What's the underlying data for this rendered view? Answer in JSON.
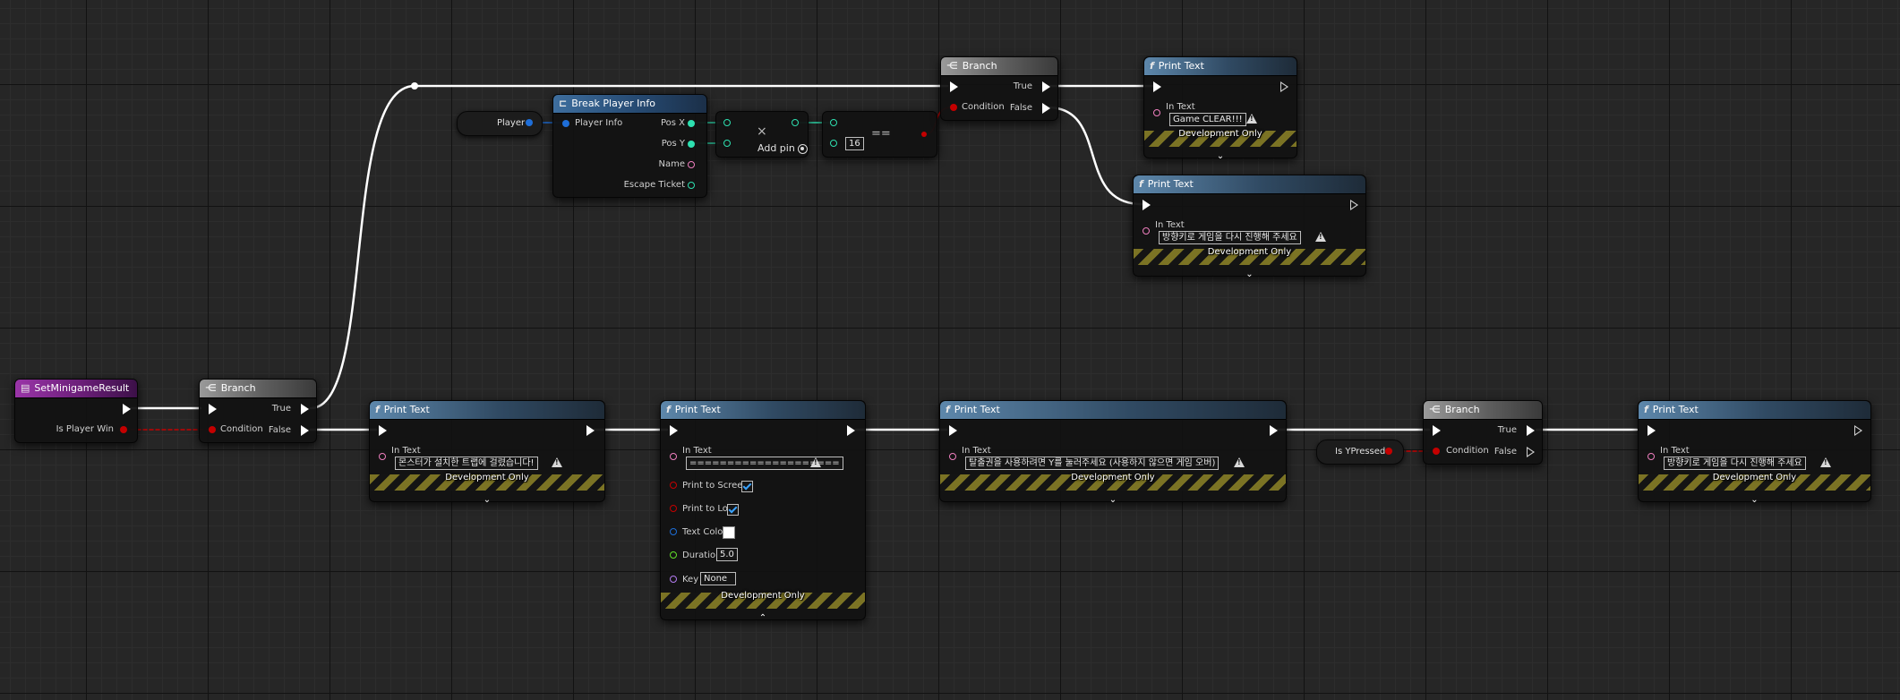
{
  "nodes": {
    "event": {
      "title": "SetMinigameResult",
      "out_pin": "Is Player Win"
    },
    "branch_main": {
      "title": "Branch",
      "condition": "Condition",
      "true_label": "True",
      "false_label": "False"
    },
    "branch_top": {
      "title": "Branch",
      "condition": "Condition",
      "true_label": "True",
      "false_label": "False"
    },
    "branch_y": {
      "title": "Branch",
      "condition": "Condition",
      "true_label": "True",
      "false_label": "False"
    },
    "player_var": {
      "label": "Player"
    },
    "is_y_pressed": {
      "label": "Is YPressed"
    },
    "break_player_info": {
      "title": "Break Player Info",
      "input": "Player Info",
      "outputs": [
        "Pos X",
        "Pos Y",
        "Name",
        "Escape Ticket"
      ]
    },
    "multiply": {
      "symbol": "×",
      "add_pin": "Add pin"
    },
    "equals": {
      "symbol": "==",
      "value": "16"
    },
    "print_clear": {
      "title": "Print Text",
      "in_text_label": "In Text",
      "in_text": "Game CLEAR!!!",
      "footer": "Development Only"
    },
    "print_retry_top": {
      "title": "Print Text",
      "in_text_label": "In Text",
      "in_text": "방향키로 게임을 다시 진행해 주세요",
      "footer": "Development Only"
    },
    "print_trap": {
      "title": "Print Text",
      "in_text_label": "In Text",
      "in_text": "몬스터가 설치한 트랩에 걸렸습니다!",
      "footer": "Development Only"
    },
    "print_separator": {
      "title": "Print Text",
      "in_text_label": "In Text",
      "in_text": "====================",
      "print_to_screen": "Print to Screen",
      "print_to_log": "Print to Log",
      "text_color": "Text Color",
      "duration_label": "Duration",
      "duration": "5.0",
      "key_label": "Key",
      "key": "None",
      "footer": "Development Only"
    },
    "print_escape": {
      "title": "Print Text",
      "in_text_label": "In Text",
      "in_text": "탈출권을 사용하려면 Y를 눌러주세요 (사용하지 않으면 게임 오버)",
      "footer": "Development Only"
    },
    "print_retry_bottom": {
      "title": "Print Text",
      "in_text_label": "In Text",
      "in_text": "방향키로 게임을 다시 진행해 주세요",
      "footer": "Development Only"
    }
  },
  "icons": {
    "function": "f",
    "branch": "branch-icon",
    "break": "break-struct-icon",
    "expand": "⌄",
    "collapse": "⌃"
  },
  "colors": {
    "exec_wire": "#ffffff",
    "bool_wire": "#c40000",
    "numeric_wire": "#2ee0b0",
    "struct_wire": "#1e6ed8",
    "print_header": "#5d87ab",
    "event_header": "#9a35a8",
    "branch_header": "#9a9a9a"
  }
}
